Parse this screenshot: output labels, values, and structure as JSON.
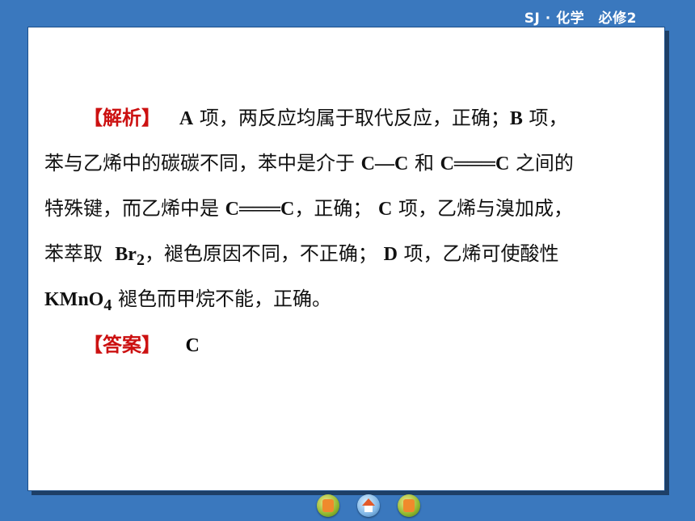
{
  "header": {
    "label": "SJ · 化学　必修2"
  },
  "analysis": {
    "tag": "【解析】",
    "lines": [
      {
        "a": "A",
        "b": "项，两反应均属于取代反应，正确；",
        "c": "B",
        "d": "项，"
      },
      {
        "a": "苯与乙烯中的碳碳不同，苯中是介于",
        "b": "C—C",
        "c": "和",
        "d": "C═══C",
        "e": "之间的"
      },
      {
        "a": "特殊键，而乙烯中是",
        "b": "C═══C",
        "c": "，正确；",
        "d": "C",
        "e": "项，乙烯与溴加成，"
      },
      {
        "a": "苯萃取",
        "b": "Br",
        "sub": "2",
        "c": "，褪色原因不同，不正确；",
        "d": "D",
        "e": "项，乙烯可使酸性"
      },
      {
        "a": "KMnO",
        "sub": "4",
        "b": "褪色而甲烷不能，正确。"
      }
    ]
  },
  "answer": {
    "tag": "【答案】",
    "value": "C"
  },
  "nav": {
    "prev": "arrow-left-icon",
    "home": "home-icon",
    "next": "arrow-right-icon"
  }
}
